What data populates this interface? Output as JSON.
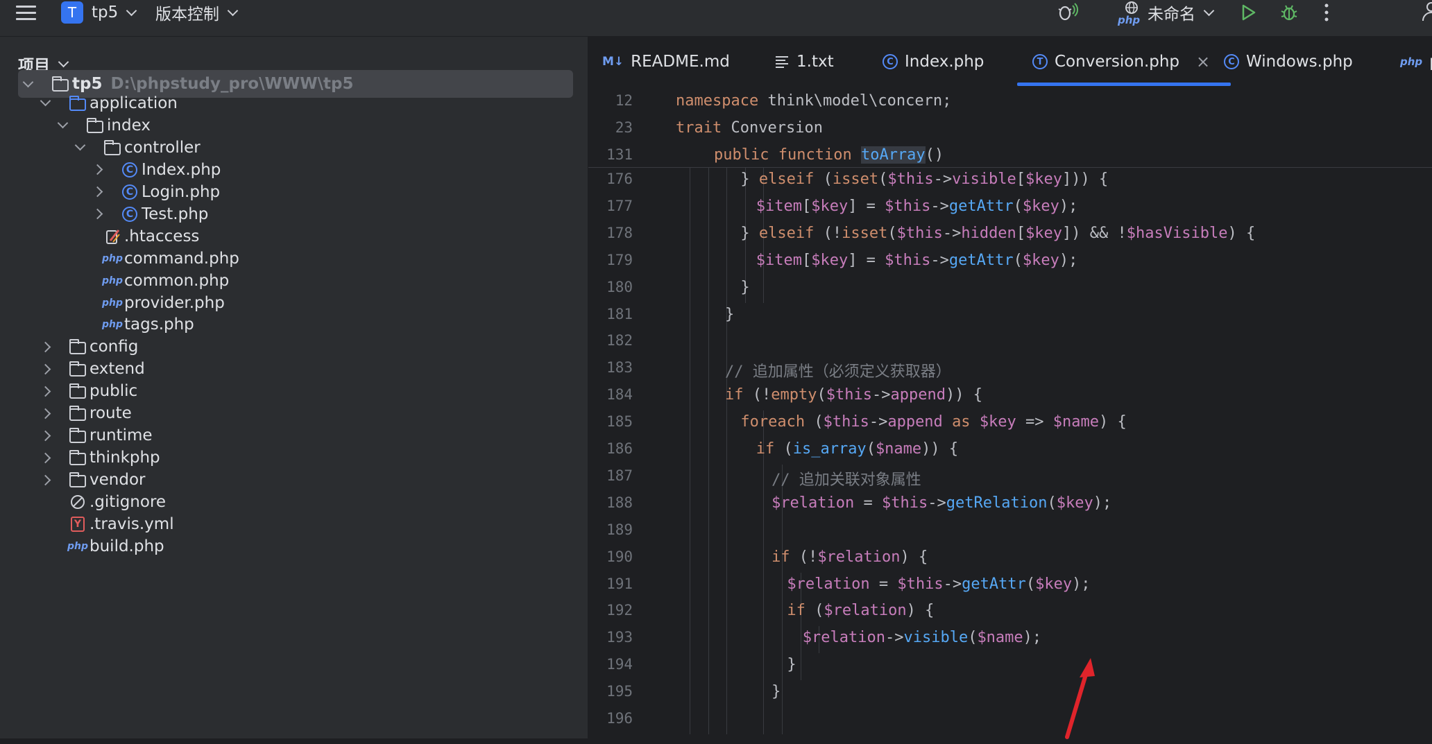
{
  "topbar": {
    "project_initial": "T",
    "project_name": "tp5",
    "vcs_label": "版本控制",
    "php_label": "php",
    "interpreter_label": "未命名"
  },
  "sidebar": {
    "title": "项目",
    "tree": [
      {
        "label": "tp5",
        "path": "D:\\phpstudy_pro\\WWW\\tp5",
        "type": "folder",
        "expanded": true,
        "bold": true
      },
      {
        "label": "application",
        "type": "folder-blue",
        "expanded": true
      },
      {
        "label": "index",
        "type": "folder",
        "expanded": true
      },
      {
        "label": "controller",
        "type": "folder",
        "expanded": true
      },
      {
        "label": "Index.php",
        "type": "class",
        "expanded": false
      },
      {
        "label": "Login.php",
        "type": "class",
        "expanded": false
      },
      {
        "label": "Test.php",
        "type": "class",
        "expanded": false
      },
      {
        "label": ".htaccess",
        "type": "htaccess"
      },
      {
        "label": "command.php",
        "type": "php"
      },
      {
        "label": "common.php",
        "type": "php"
      },
      {
        "label": "provider.php",
        "type": "php"
      },
      {
        "label": "tags.php",
        "type": "php"
      },
      {
        "label": "config",
        "type": "folder",
        "expanded": false
      },
      {
        "label": "extend",
        "type": "folder",
        "expanded": false
      },
      {
        "label": "public",
        "type": "folder",
        "expanded": false
      },
      {
        "label": "route",
        "type": "folder",
        "expanded": false
      },
      {
        "label": "runtime",
        "type": "folder",
        "expanded": false
      },
      {
        "label": "thinkphp",
        "type": "folder",
        "expanded": false
      },
      {
        "label": "vendor",
        "type": "folder",
        "expanded": false
      },
      {
        "label": ".gitignore",
        "type": "ignore"
      },
      {
        "label": ".travis.yml",
        "type": "yaml"
      },
      {
        "label": "build.php",
        "type": "php"
      }
    ]
  },
  "tabs": [
    {
      "label": "README.md",
      "icon": "markdown-icon"
    },
    {
      "label": "1.txt",
      "icon": "text-file-icon"
    },
    {
      "label": "Index.php",
      "icon": "class-icon"
    },
    {
      "label": "Conversion.php",
      "icon": "trait-icon",
      "active": true
    },
    {
      "label": "Windows.php",
      "icon": "class-icon"
    },
    {
      "label": "p",
      "icon": "php-icon"
    }
  ],
  "icons": {
    "md": "M↓",
    "class": "C",
    "trait": "T",
    "php": "php",
    "yaml": "Y",
    "close": "×"
  },
  "colors": {
    "accent": "#3574f0",
    "keyword": "#cf8e6d",
    "variable": "#c77dbb",
    "function": "#56a8f5",
    "annotation_arrow": "#e0242b"
  },
  "sticky_lines": [
    {
      "num": "12",
      "text": "namespace think\\model\\concern;"
    },
    {
      "num": "23",
      "text": "trait Conversion"
    },
    {
      "num": "131",
      "text": "public function toArray()"
    }
  ],
  "code_lines": [
    {
      "num": "176"
    },
    {
      "num": "177"
    },
    {
      "num": "178"
    },
    {
      "num": "179"
    },
    {
      "num": "180"
    },
    {
      "num": "181"
    },
    {
      "num": "182"
    },
    {
      "num": "183"
    },
    {
      "num": "184"
    },
    {
      "num": "185"
    },
    {
      "num": "186"
    },
    {
      "num": "187"
    },
    {
      "num": "188"
    },
    {
      "num": "189"
    },
    {
      "num": "190"
    },
    {
      "num": "191"
    },
    {
      "num": "192"
    },
    {
      "num": "193"
    },
    {
      "num": "194"
    },
    {
      "num": "195"
    },
    {
      "num": "196"
    }
  ],
  "code": {
    "l176": [
      "} ",
      "elseif",
      " (",
      "isset",
      "(",
      "$this",
      "->",
      "visible",
      "[",
      "$key",
      "])) {"
    ],
    "l177": [
      "$item",
      "[",
      "$key",
      "] = ",
      "$this",
      "->",
      "getAttr",
      "(",
      "$key",
      ");"
    ],
    "l178": [
      "} ",
      "elseif",
      " (!",
      "isset",
      "(",
      "$this",
      "->",
      "hidden",
      "[",
      "$key",
      "]) && !",
      "$hasVisible",
      ") {"
    ],
    "l179": [
      "$item",
      "[",
      "$key",
      "] = ",
      "$this",
      "->",
      "getAttr",
      "(",
      "$key",
      ");"
    ],
    "l180": "}",
    "l181": "}",
    "l183": "// 追加属性（必须定义获取器）",
    "l184": [
      "if",
      " (!",
      "empty",
      "(",
      "$this",
      "->",
      "append",
      ")) {"
    ],
    "l185": [
      "foreach",
      " (",
      "$this",
      "->",
      "append",
      " ",
      "as",
      " ",
      "$key",
      " => ",
      "$name",
      ") {"
    ],
    "l186": [
      "if",
      " (",
      "is_array",
      "(",
      "$name",
      ")) {"
    ],
    "l187": "// 追加关联对象属性",
    "l188": [
      "$relation",
      " = ",
      "$this",
      "->",
      "getRelation",
      "(",
      "$key",
      ");"
    ],
    "l190": [
      "if",
      " (!",
      "$relation",
      ") {"
    ],
    "l191": [
      "$relation",
      " = ",
      "$this",
      "->",
      "getAttr",
      "(",
      "$key",
      ");"
    ],
    "l192": [
      "if",
      " (",
      "$relation",
      ") {"
    ],
    "l193": [
      "$relation",
      "->",
      "visible",
      "(",
      "$name",
      ");"
    ],
    "l194": "}",
    "l195": "}"
  }
}
